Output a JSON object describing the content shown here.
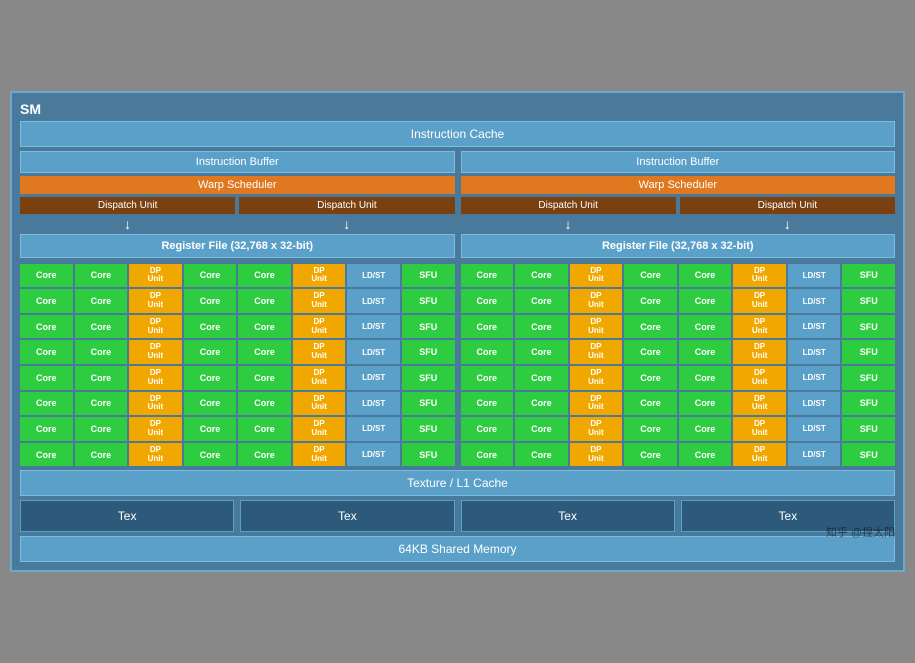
{
  "title": "SM",
  "instruction_cache": "Instruction Cache",
  "left": {
    "instr_buffer": "Instruction Buffer",
    "warp_scheduler": "Warp Scheduler",
    "dispatch1": "Dispatch Unit",
    "dispatch2": "Dispatch Unit",
    "register_file": "Register File (32,768 x 32-bit)"
  },
  "right": {
    "instr_buffer": "Instruction Buffer",
    "warp_scheduler": "Warp Scheduler",
    "dispatch1": "Dispatch Unit",
    "dispatch2": "Dispatch Unit",
    "register_file": "Register File (32,768 x 32-bit)"
  },
  "rows": [
    [
      "Core",
      "Core",
      "DP Unit",
      "Core",
      "Core",
      "DP Unit",
      "LD/ST",
      "SFU"
    ],
    [
      "Core",
      "Core",
      "DP Unit",
      "Core",
      "Core",
      "DP Unit",
      "LD/ST",
      "SFU"
    ],
    [
      "Core",
      "Core",
      "DP Unit",
      "Core",
      "Core",
      "DP Unit",
      "LD/ST",
      "SFU"
    ],
    [
      "Core",
      "Core",
      "DP Unit",
      "Core",
      "Core",
      "DP Unit",
      "LD/ST",
      "SFU"
    ],
    [
      "Core",
      "Core",
      "DP Unit",
      "Core",
      "Core",
      "DP Unit",
      "LD/ST",
      "SFU"
    ],
    [
      "Core",
      "Core",
      "DP Unit",
      "Core",
      "Core",
      "DP Unit",
      "LD/ST",
      "SFU"
    ],
    [
      "Core",
      "Core",
      "DP Unit",
      "Core",
      "Core",
      "DP Unit",
      "LD/ST",
      "SFU"
    ],
    [
      "Core",
      "Core",
      "DP Unit",
      "Core",
      "Core",
      "DP Unit",
      "LD/ST",
      "SFU"
    ]
  ],
  "texture_cache": "Texture / L1 Cache",
  "tex_units": [
    "Tex",
    "Tex",
    "Tex",
    "Tex"
  ],
  "shared_memory": "64KB Shared Memory",
  "watermark": "知乎 @捏太阳"
}
